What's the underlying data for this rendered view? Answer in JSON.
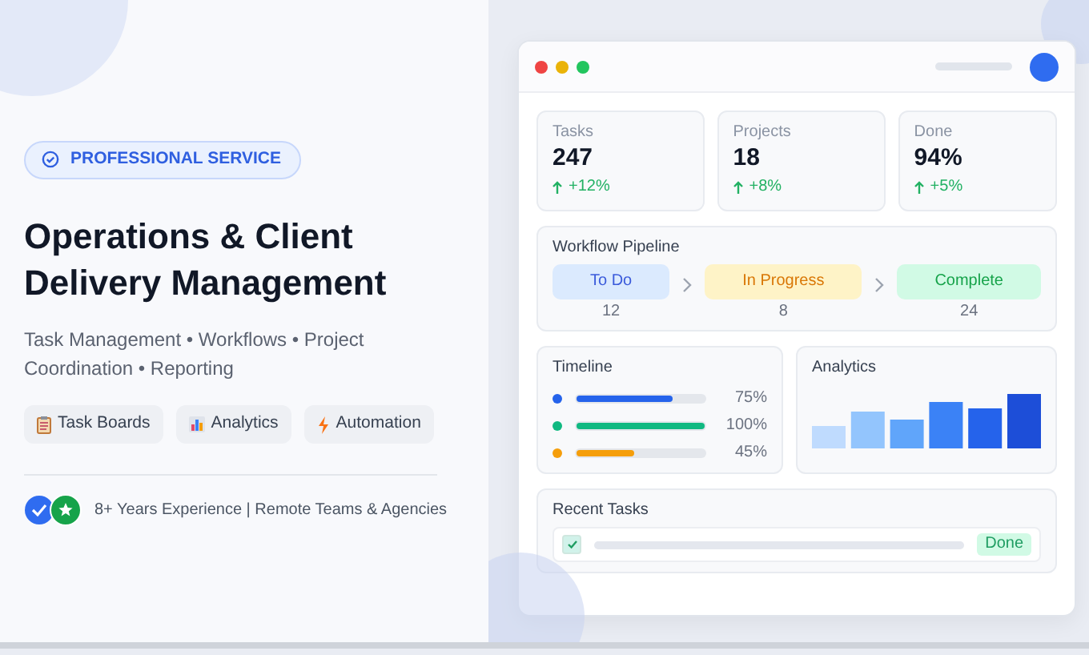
{
  "badge": {
    "text": "PROFESSIONAL SERVICE"
  },
  "title": "Operations & Client Delivery Management",
  "subtitle": "Task Management • Workflows • Project Coordination • Reporting",
  "tags": [
    {
      "kind": "clipboard",
      "label": "Task Boards"
    },
    {
      "kind": "chart",
      "label": "Analytics"
    },
    {
      "kind": "bolt",
      "label": "Automation"
    }
  ],
  "footer": {
    "text": "8+ Years Experience | Remote Teams & Agencies"
  },
  "dashboard": {
    "stats": [
      {
        "label": "Tasks",
        "value": "247",
        "change": "+12%"
      },
      {
        "label": "Projects",
        "value": "18",
        "change": "+8%"
      },
      {
        "label": "Done",
        "value": "94%",
        "change": "+5%"
      }
    ],
    "pipeline": {
      "title": "Workflow Pipeline",
      "stages": [
        {
          "label": "To Do",
          "count": "12",
          "color": "#dbeafe"
        },
        {
          "label": "In Progress",
          "count": "8",
          "color": "#fef3c7"
        },
        {
          "label": "Complete",
          "count": "24",
          "color": "#d1fae5"
        }
      ]
    },
    "timeline": {
      "title": "Timeline",
      "rows": [
        {
          "color": "#2563eb",
          "level": 0.75,
          "reading": "75%"
        },
        {
          "color": "#10b981",
          "level": 1.0,
          "reading": "100%"
        },
        {
          "color": "#f59e0b",
          "level": 0.45,
          "reading": "45%"
        }
      ]
    },
    "analytics": {
      "title": "Analytics"
    },
    "recent": {
      "title": "Recent Tasks",
      "tasks": [
        {
          "checked": true,
          "status": "Done"
        }
      ]
    }
  }
}
